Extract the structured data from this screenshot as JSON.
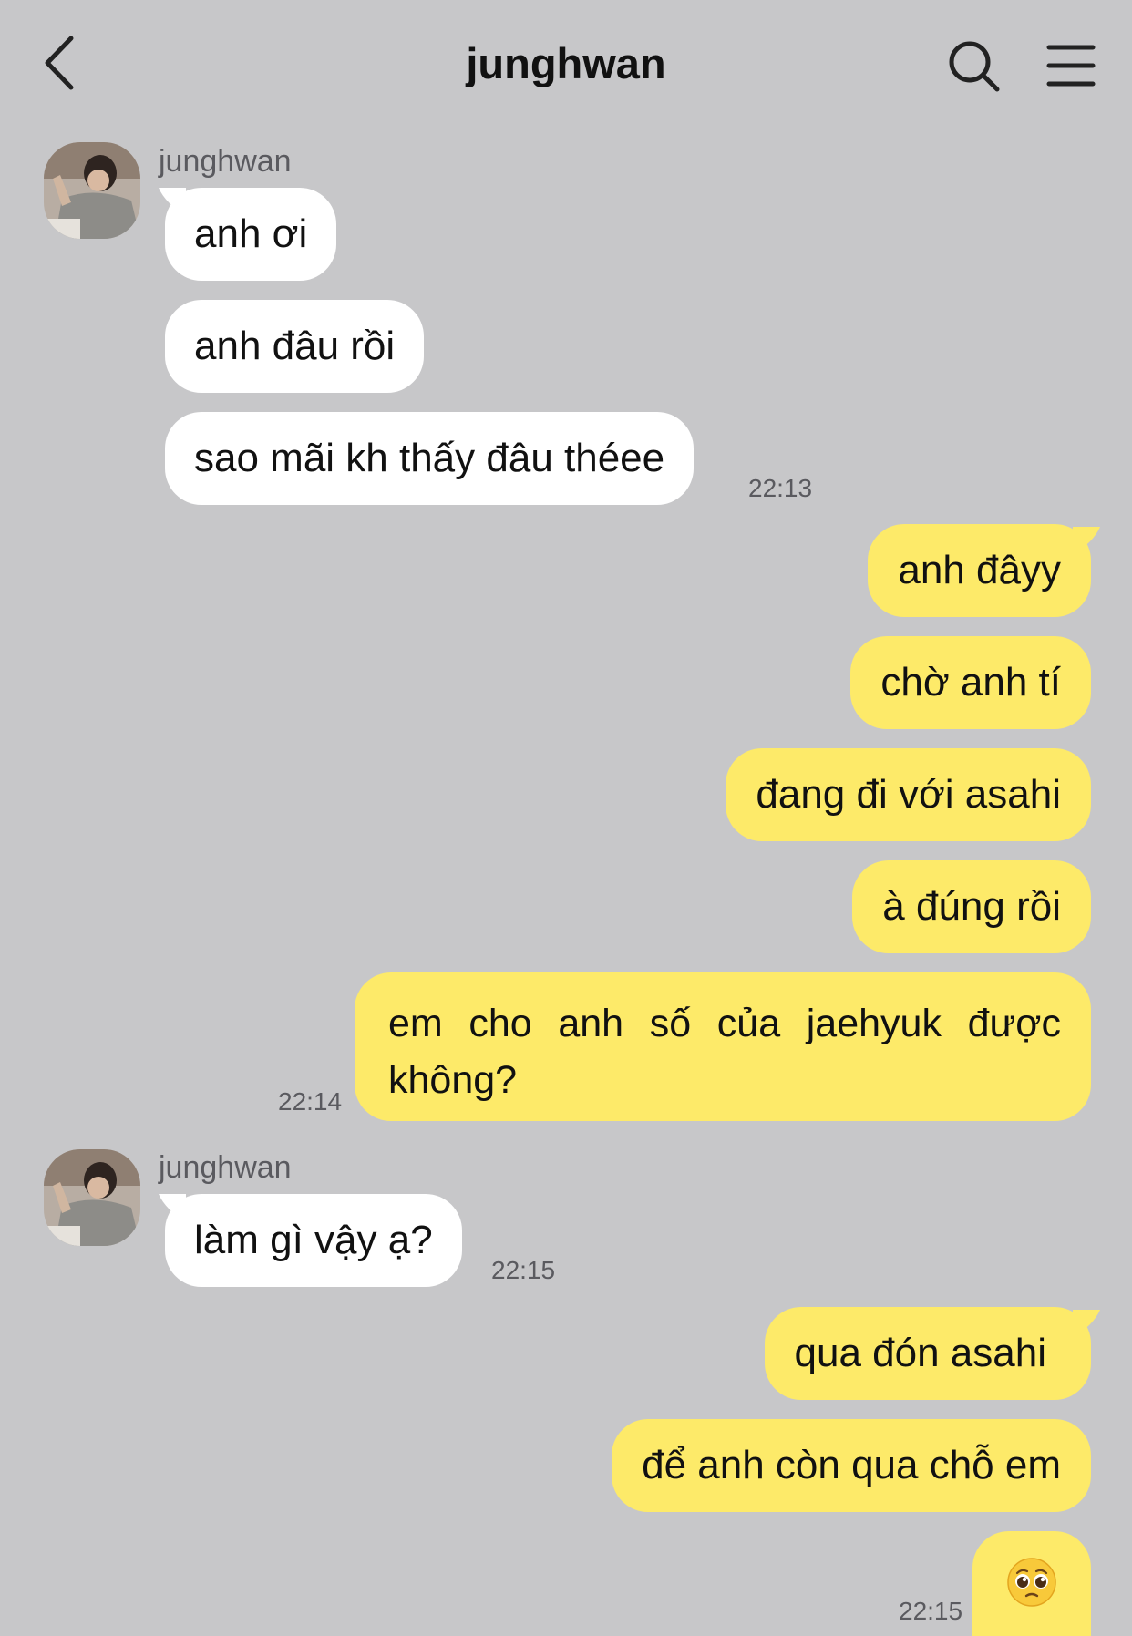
{
  "header": {
    "title": "junghwan",
    "back_icon": "chevron-left-icon",
    "search_icon": "search-icon",
    "menu_icon": "hamburger-menu-icon"
  },
  "colors": {
    "background": "#c7c7c9",
    "incoming_bubble": "#ffffff",
    "outgoing_bubble": "#fdea69",
    "timestamp": "#5a5a5f"
  },
  "messages": [
    {
      "from": "junghwan",
      "text": "anh ơi"
    },
    {
      "from": "junghwan",
      "text": "anh đâu rồi"
    },
    {
      "from": "junghwan",
      "text": "sao mãi kh thấy đâu théee",
      "time": "22:13"
    },
    {
      "from": "me",
      "text": "anh đâyy"
    },
    {
      "from": "me",
      "text": "chờ anh tí"
    },
    {
      "from": "me",
      "text": "đang đi với asahi"
    },
    {
      "from": "me",
      "text": "à đúng rồi"
    },
    {
      "from": "me",
      "text": "em cho anh số của jaehyuk được không?",
      "time": "22:14"
    },
    {
      "from": "junghwan",
      "text": "làm gì vậy ạ?",
      "time": "22:15"
    },
    {
      "from": "me",
      "text": "qua đón asahi"
    },
    {
      "from": "me",
      "text": "để anh còn qua chỗ em"
    },
    {
      "from": "me",
      "text": "",
      "emoji": "pleading-face-emoji",
      "time": "22:15"
    }
  ]
}
